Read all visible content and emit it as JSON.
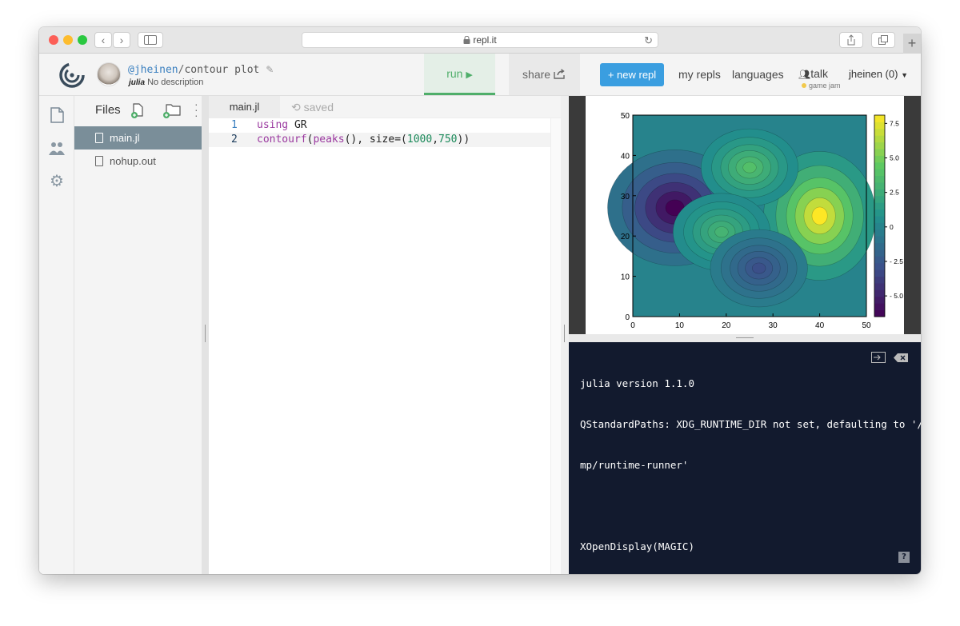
{
  "browser": {
    "url": "repl.it"
  },
  "header": {
    "user_handle": "@jheinen",
    "slash": "/",
    "repl_name": "contour plot",
    "language_badge": "julia",
    "description": "No description",
    "run_label": "run",
    "share_label": "share",
    "new_repl_label": "+ new repl",
    "my_repls_label": "my repls",
    "languages_label": "languages",
    "talk_label": "talk",
    "game_jam_label": "game jam",
    "user_menu_label": "jheinen (0)"
  },
  "files": {
    "title": "Files",
    "items": [
      {
        "name": "main.jl",
        "selected": true
      },
      {
        "name": "nohup.out",
        "selected": false
      }
    ]
  },
  "editor": {
    "tab_label": "main.jl",
    "saved_label": "saved",
    "lines": [
      {
        "num": "1",
        "kw": "using",
        "rest": " GR"
      },
      {
        "num": "2",
        "fn": "contourf",
        "p1": "(",
        "fn2": "peaks",
        "p2": "(), size=(",
        "n1": "1000",
        "comma": ",",
        "n2": "750",
        "p3": "))"
      }
    ]
  },
  "chart_data": {
    "type": "heatmap",
    "xlim": [
      0,
      50
    ],
    "ylim": [
      0,
      50
    ],
    "x_ticks": [
      "0",
      "10",
      "20",
      "30",
      "40",
      "50"
    ],
    "y_ticks": [
      "0",
      "10",
      "20",
      "30",
      "40",
      "50"
    ],
    "colorbar_ticks": [
      "7.5",
      "5.0",
      "2.5",
      "0",
      "- 2.5",
      "- 5.0"
    ],
    "colorbar_range": [
      -6.5,
      8.1
    ],
    "colormap": [
      "#440154",
      "#3b528b",
      "#21918c",
      "#5ec962",
      "#fde725"
    ],
    "peaks": [
      {
        "x": 9,
        "y": 27,
        "value": -6.5
      },
      {
        "x": 40,
        "y": 25,
        "value": 8.1
      },
      {
        "x": 25,
        "y": 37,
        "value": 3.8
      },
      {
        "x": 19,
        "y": 21,
        "value": 3.0
      },
      {
        "x": 27,
        "y": 12,
        "value": -3.0
      }
    ]
  },
  "console": {
    "lines": [
      "julia version 1.1.0",
      "QStandardPaths: XDG_RUNTIME_DIR not set, defaulting to '/t",
      "mp/runtime-runner'",
      "",
      "XOpenDisplay(MAGIC)"
    ],
    "prompt": "›",
    "help_label": "?"
  },
  "colors": {
    "run_green": "#4fae6a",
    "new_repl_blue": "#3a9ee0",
    "selected_file": "#7a8e99",
    "console_bg": "#121a2e",
    "keyword": "#9b3aa0",
    "number": "#1b8a5a"
  }
}
